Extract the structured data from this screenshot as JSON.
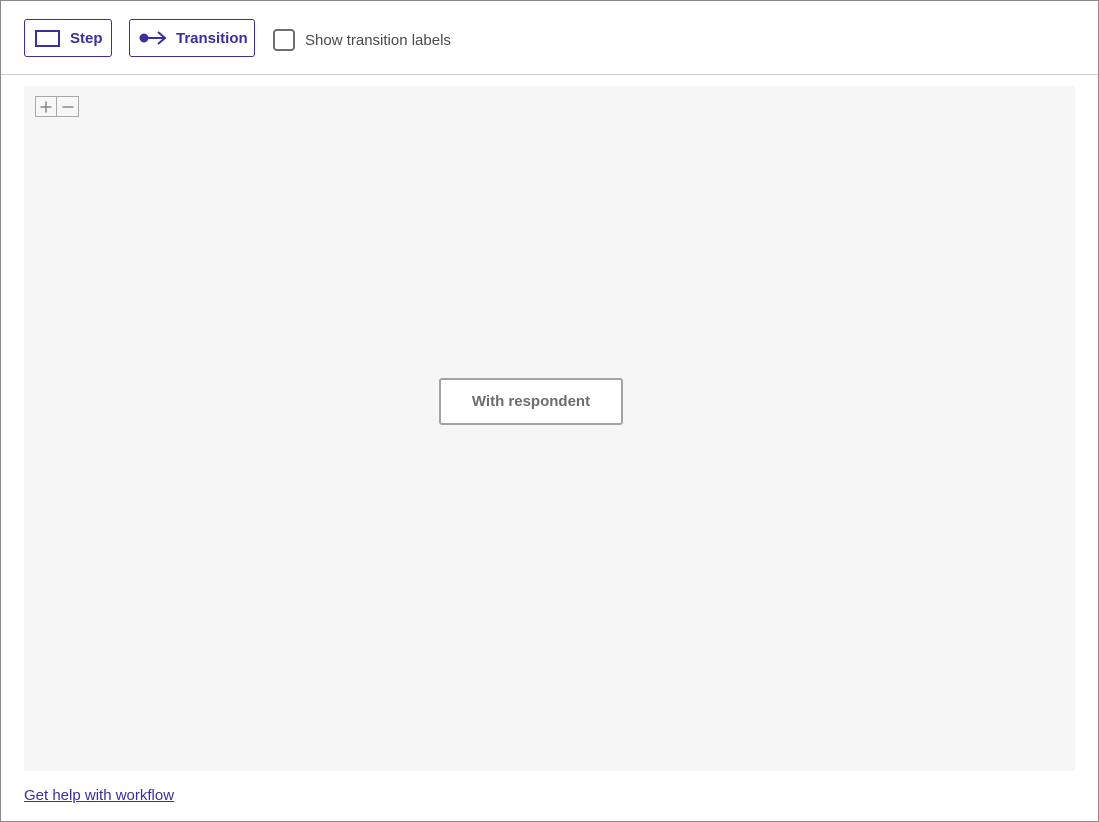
{
  "toolbar": {
    "step_label": "Step",
    "step_icon": "rectangle-icon",
    "transition_label": "Transition",
    "transition_icon": "arrow-right-icon",
    "show_labels_text": "Show transition labels",
    "show_labels_checked": false
  },
  "canvas": {
    "zoom_in_icon": "plus-icon",
    "zoom_out_icon": "minus-icon",
    "nodes": [
      {
        "label": "With respondent"
      }
    ]
  },
  "footer": {
    "help_link": "Get help with workflow"
  },
  "colors": {
    "accent": "#3a2fa0",
    "canvas_bg": "#f6f6f6",
    "node_border": "#a3a3a3",
    "node_text": "#6d6d6d"
  }
}
